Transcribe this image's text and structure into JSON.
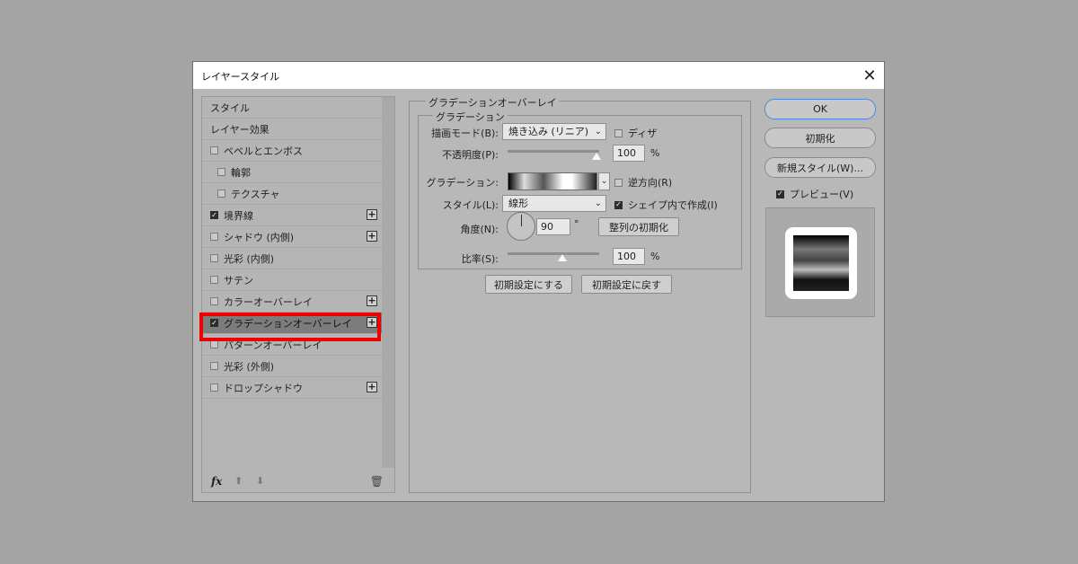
{
  "window": {
    "title": "レイヤースタイル",
    "close_glyph": "✕"
  },
  "sidebar": {
    "items": [
      {
        "label": "スタイル",
        "checkbox": false,
        "checked": false,
        "indent": false,
        "plus": false,
        "selected": false
      },
      {
        "label": "レイヤー効果",
        "checkbox": false,
        "checked": false,
        "indent": false,
        "plus": false,
        "selected": false
      },
      {
        "label": "ベベルとエンボス",
        "checkbox": true,
        "checked": false,
        "indent": false,
        "plus": false,
        "selected": false
      },
      {
        "label": "輪郭",
        "checkbox": true,
        "checked": false,
        "indent": true,
        "plus": false,
        "selected": false
      },
      {
        "label": "テクスチャ",
        "checkbox": true,
        "checked": false,
        "indent": true,
        "plus": false,
        "selected": false
      },
      {
        "label": "境界線",
        "checkbox": true,
        "checked": true,
        "indent": false,
        "plus": true,
        "selected": false
      },
      {
        "label": "シャドウ (内側)",
        "checkbox": true,
        "checked": false,
        "indent": false,
        "plus": true,
        "selected": false
      },
      {
        "label": "光彩 (内側)",
        "checkbox": true,
        "checked": false,
        "indent": false,
        "plus": false,
        "selected": false
      },
      {
        "label": "サテン",
        "checkbox": true,
        "checked": false,
        "indent": false,
        "plus": false,
        "selected": false
      },
      {
        "label": "カラーオーバーレイ",
        "checkbox": true,
        "checked": false,
        "indent": false,
        "plus": true,
        "selected": false
      },
      {
        "label": "グラデーションオーバーレイ",
        "checkbox": true,
        "checked": true,
        "indent": false,
        "plus": true,
        "selected": true
      },
      {
        "label": "パターンオーバーレイ",
        "checkbox": true,
        "checked": false,
        "indent": false,
        "plus": false,
        "selected": false
      },
      {
        "label": "光彩 (外側)",
        "checkbox": true,
        "checked": false,
        "indent": false,
        "plus": false,
        "selected": false
      },
      {
        "label": "ドロップシャドウ",
        "checkbox": true,
        "checked": false,
        "indent": false,
        "plus": true,
        "selected": false
      }
    ],
    "footer": {
      "fx": "fx",
      "up": "⬆",
      "down": "⬇",
      "trash": "🗑"
    },
    "highlight_color": "#ee0000"
  },
  "panel": {
    "section_title": "グラデーションオーバーレイ",
    "group_title": "グラデーション",
    "blend_label": "描画モード(B):",
    "blend_value": "焼き込み (リニア)",
    "dither_label": "ディザ",
    "opacity_label": "不透明度(P):",
    "opacity_value": "100",
    "opacity_unit": "%",
    "opacity_level": 1.0,
    "gradient_label": "グラデーション:",
    "reverse_label": "逆方向(R)",
    "style_label": "スタイル(L):",
    "style_value": "線形",
    "align_label": "シェイプ内で作成(I)",
    "angle_label": "角度(N):",
    "angle_value": "90",
    "angle_unit": "°",
    "reset_align_label": "整列の初期化",
    "scale_label": "比率(S):",
    "scale_value": "100",
    "scale_unit": "%",
    "scale_level": 0.6,
    "make_default_label": "初期設定にする",
    "reset_default_label": "初期設定に戻す"
  },
  "actions": {
    "ok": "OK",
    "reset": "初期化",
    "new_style": "新規スタイル(W)...",
    "preview_label": "プレビュー(V)"
  },
  "colors": {
    "ok_border": "#4f88d6",
    "selected_row": "#7c7c7c"
  }
}
